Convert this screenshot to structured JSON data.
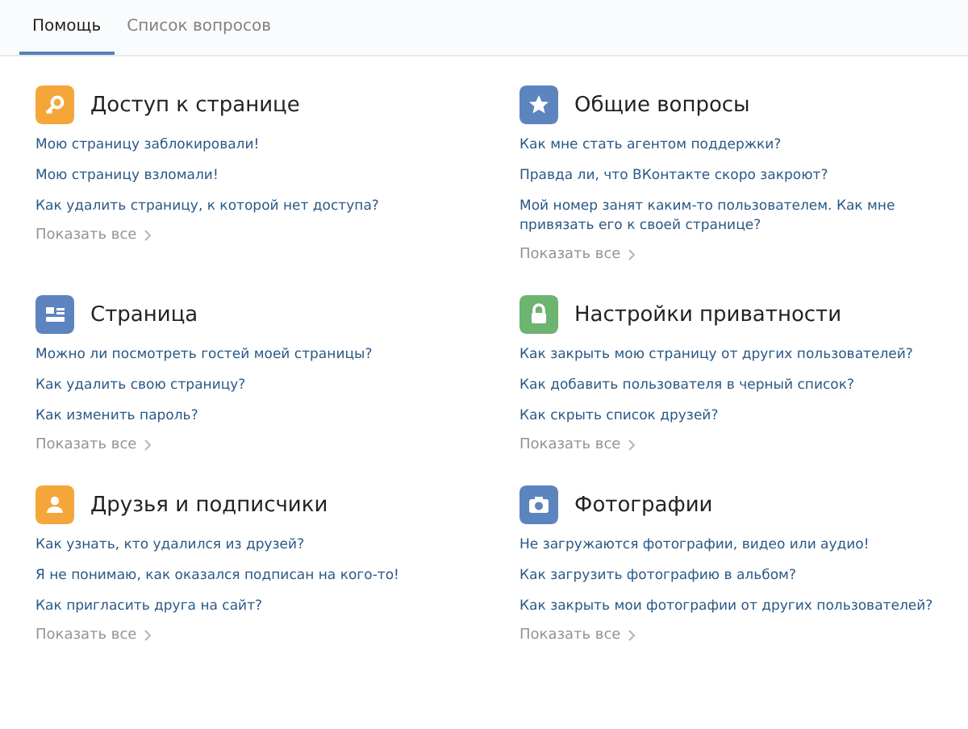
{
  "tabs": [
    {
      "label": "Помощь",
      "selected": true
    },
    {
      "label": "Список вопросов",
      "selected": false
    }
  ],
  "sections": [
    {
      "title": "Доступ к странице",
      "kind": "key",
      "color": "#f5a63a",
      "questions": [
        "Мою страницу заблокировали!",
        "Мою страницу взломали!",
        "Как удалить страницу, к которой нет доступа?"
      ],
      "more": "Показать все"
    },
    {
      "title": "Общие вопросы",
      "kind": "star",
      "color": "#5c84be",
      "questions": [
        "Как мне стать агентом поддержки?",
        "Правда ли, что ВКонтакте скоро закроют?",
        "Мой номер занят каким-то пользователем. Как мне привязать его к своей странице?"
      ],
      "more": "Показать все"
    },
    {
      "title": "Страница",
      "kind": "card",
      "color": "#5c84be",
      "questions": [
        "Можно ли посмотреть гостей моей страницы?",
        "Как удалить свою страницу?",
        "Как изменить пароль?"
      ],
      "more": "Показать все"
    },
    {
      "title": "Настройки приватности",
      "kind": "lock",
      "color": "#6cb46f",
      "questions": [
        "Как закрыть мою страницу от других пользователей?",
        "Как добавить пользователя в черный список?",
        "Как скрыть список друзей?"
      ],
      "more": "Показать все"
    },
    {
      "title": "Друзья и подписчики",
      "kind": "person",
      "color": "#f5a63a",
      "questions": [
        "Как узнать, кто удалился из друзей?",
        "Я не понимаю, как оказался подписан на кого-то!",
        "Как пригласить друга на сайт?"
      ],
      "more": "Показать все"
    },
    {
      "title": "Фотографии",
      "kind": "camera",
      "color": "#5c84be",
      "questions": [
        "Не загружаются фотографии, видео или аудио!",
        "Как загрузить фотографию в альбом?",
        "Как закрыть мои фотографии от других пользователей?"
      ],
      "more": "Показать все"
    }
  ]
}
